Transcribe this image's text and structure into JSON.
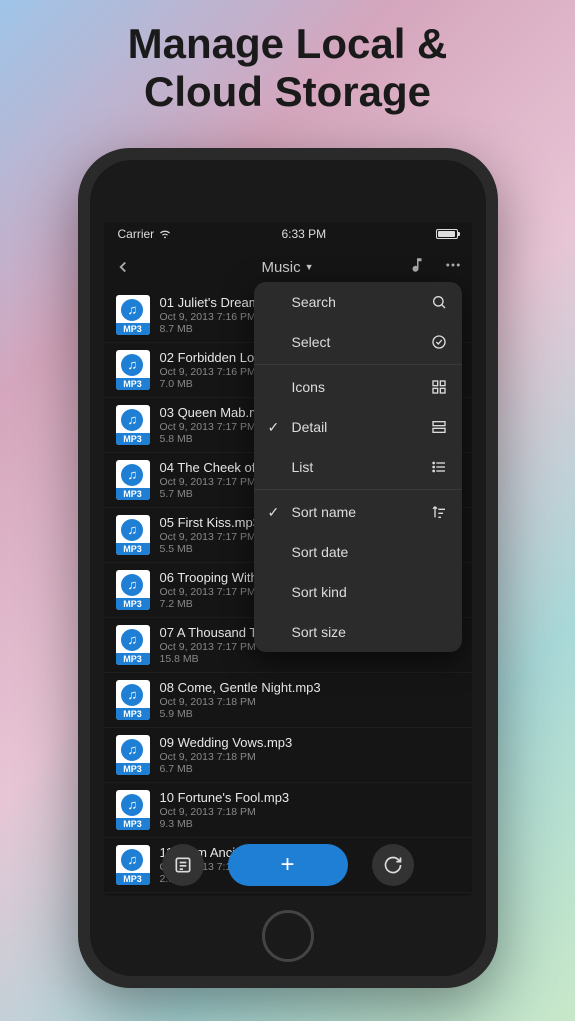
{
  "hero": {
    "line1": "Manage Local &",
    "line2": "Cloud Storage"
  },
  "status": {
    "carrier": "Carrier",
    "time": "6:33 PM"
  },
  "nav": {
    "title": "Music"
  },
  "files": [
    {
      "name": "01 Juliet's Dream.mp3",
      "date": "Oct 9, 2013 7:16 PM",
      "size": "8.7 MB"
    },
    {
      "name": "02 Forbidden Love.mp3",
      "date": "Oct 9, 2013 7:16 PM",
      "size": "7.0 MB"
    },
    {
      "name": "03 Queen Mab.mp3",
      "date": "Oct 9, 2013 7:17 PM",
      "size": "5.8 MB"
    },
    {
      "name": "04 The Cheek of Night.mp3",
      "date": "Oct 9, 2013 7:17 PM",
      "size": "5.7 MB"
    },
    {
      "name": "05 First Kiss.mp3",
      "date": "Oct 9, 2013 7:17 PM",
      "size": "5.5 MB"
    },
    {
      "name": "06 Trooping With Crows.mp3",
      "date": "Oct 9, 2013 7:17 PM",
      "size": "7.2 MB"
    },
    {
      "name": "07 A Thousand Times Good Night.mp3",
      "date": "Oct 9, 2013 7:17 PM",
      "size": "15.8 MB"
    },
    {
      "name": "08 Come, Gentle Night.mp3",
      "date": "Oct 9, 2013 7:18 PM",
      "size": "5.9 MB"
    },
    {
      "name": "09 Wedding Vows.mp3",
      "date": "Oct 9, 2013 7:18 PM",
      "size": "6.7 MB"
    },
    {
      "name": "10 Fortune's Fool.mp3",
      "date": "Oct 9, 2013 7:18 PM",
      "size": "9.3 MB"
    },
    {
      "name": "11 From Ancient Grudge.mp3",
      "date": "Oct 9, 2013 7:18 PM",
      "size": "2.9 MB"
    }
  ],
  "popover": {
    "search": "Search",
    "select": "Select",
    "icons": "Icons",
    "detail": "Detail",
    "list": "List",
    "sort_name": "Sort name",
    "sort_date": "Sort date",
    "sort_kind": "Sort kind",
    "sort_size": "Sort size"
  }
}
